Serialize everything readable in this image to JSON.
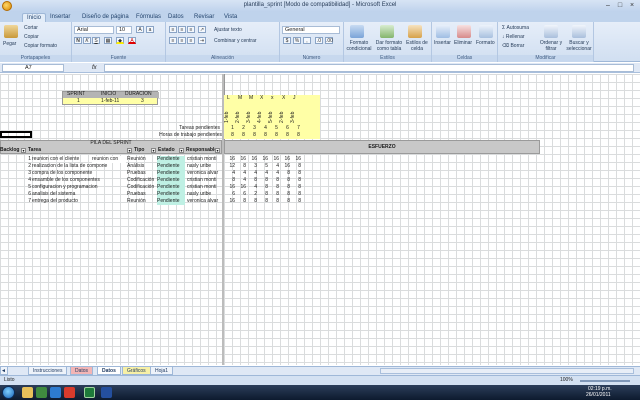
{
  "window": {
    "title": "plantilla_sprint [Modo de compatibilidad] - Microsoft Excel"
  },
  "tabs": [
    "Inicio",
    "Insertar",
    "Diseño de página",
    "Fórmulas",
    "Datos",
    "Revisar",
    "Vista"
  ],
  "ribbon": {
    "clipboard": {
      "paste": "Pegar",
      "cut": "Cortar",
      "copy": "Copiar",
      "format_painter": "Copiar formato",
      "label": "Portapapeles"
    },
    "font": {
      "name": "Arial",
      "size": "10",
      "label": "Fuente"
    },
    "alignment": {
      "wrap": "Ajustar texto",
      "merge": "Combinar y centrar",
      "label": "Alineación"
    },
    "number": {
      "format": "General",
      "label": "Número"
    },
    "styles": {
      "conditional": "Formato condicional",
      "as_table": "Dar formato como tabla",
      "cell_styles": "Estilos de celda",
      "label": "Estilos"
    },
    "cells": {
      "insert": "Insertar",
      "delete": "Eliminar",
      "format": "Formato",
      "label": "Celdas"
    },
    "editing": {
      "autosum": "Autosuma",
      "fill": "Rellenar",
      "clear": "Borrar",
      "sort": "Ordenar y filtrar",
      "find": "Buscar y seleccionar",
      "label": "Modificar"
    }
  },
  "formula_bar": {
    "cell_ref": "A7",
    "fx": "fx",
    "value": ""
  },
  "sprint_box": {
    "headers": [
      "SPRINT",
      "INICIO",
      "DURACIÓN"
    ],
    "values": [
      "1",
      "1-feb-11",
      "3"
    ]
  },
  "days": {
    "letters": [
      "L",
      "M",
      "M",
      "X",
      "x",
      "X",
      "J"
    ],
    "dates": [
      "1-feb",
      "2-feb",
      "3-feb",
      "4-feb",
      "5-feb",
      "2-feb",
      "3-feb"
    ]
  },
  "summary": {
    "pending_tasks_label": "Tareas pendientes",
    "pending_tasks": [
      "1",
      "2",
      "3",
      "4",
      "5",
      "6",
      "7"
    ],
    "pending_hours_label": "Horas de trabajo pendientes",
    "pending_hours": [
      "8",
      "8",
      "8",
      "8",
      "8",
      "8",
      "8"
    ]
  },
  "table": {
    "title": "PILA DEL SPRINT",
    "effort_label": "ESFUERZO",
    "columns": [
      "Backlog",
      "Tarea",
      "Tipo",
      "Estado",
      "Responsable"
    ],
    "rows": [
      {
        "backlog": "1",
        "task": "reunion con el cliente",
        "task2": "reunion con",
        "type": "Reunión",
        "status": "Pendiente",
        "owner": "cristian monti",
        "effort": [
          "16",
          "16",
          "16",
          "16",
          "16",
          "16",
          "16"
        ]
      },
      {
        "backlog": "2",
        "task": "realizacion de la lista de compone",
        "task2": "",
        "type": "Análisis",
        "status": "Pendiente",
        "owner": "nasly uribe",
        "effort": [
          "12",
          "8",
          "3",
          "5",
          "4",
          "16",
          "8"
        ]
      },
      {
        "backlog": "3",
        "task": "compra de los componente",
        "task2": "",
        "type": "Pruebas",
        "status": "Pendiente",
        "owner": "veronica alvar",
        "effort": [
          "4",
          "4",
          "4",
          "4",
          "4",
          "8",
          "8"
        ]
      },
      {
        "backlog": "4",
        "task": "ensamble de los componentes",
        "task2": "",
        "type": "Codificación",
        "status": "Pendiente",
        "owner": "cristian monti",
        "effort": [
          "8",
          "4",
          "8",
          "8",
          "8",
          "8",
          "8"
        ]
      },
      {
        "backlog": "5",
        "task": "configuracion y programacion",
        "task2": "",
        "type": "Codificación",
        "status": "Pendiente",
        "owner": "cristian monti",
        "effort": [
          "16",
          "16",
          "4",
          "8",
          "8",
          "8",
          "8"
        ]
      },
      {
        "backlog": "6",
        "task": "analisis del sistema",
        "task2": "",
        "type": "Pruebas",
        "status": "Pendiente",
        "owner": "nasly uribe",
        "effort": [
          "6",
          "6",
          "2",
          "8",
          "8",
          "8",
          "8"
        ]
      },
      {
        "backlog": "7",
        "task": "entrega del producto",
        "task2": "",
        "type": "Reunión",
        "status": "Pendiente",
        "owner": "veronica alvar",
        "effort": [
          "16",
          "8",
          "8",
          "8",
          "8",
          "8",
          "8"
        ]
      }
    ]
  },
  "sheet_tabs": [
    "Instrucciones",
    "Datos",
    "Datos",
    "Gráficos",
    "Hoja1"
  ],
  "status": {
    "mode": "Listo",
    "zoom": "100%"
  },
  "taskbar": {
    "time": "02:19 p.m.",
    "date": "26/01/2011"
  }
}
